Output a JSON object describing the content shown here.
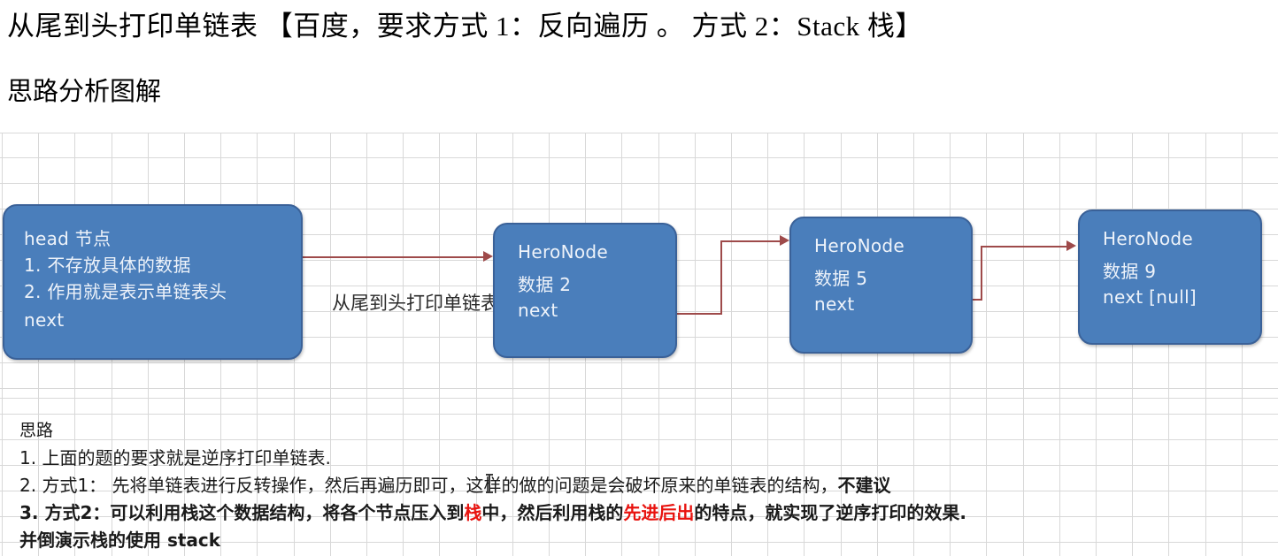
{
  "document": {
    "heading": "从尾到头打印单链表 【百度，要求方式 1：反向遍历 。 方式 2：Stack 栈】",
    "subheading": "思路分析图解"
  },
  "diagram": {
    "title": "从尾到头打印单链表",
    "node_fill": "#4a7ebb",
    "node_border": "#3a6198",
    "arrow_color": "#9e4a4a",
    "nodes": [
      {
        "id": "head",
        "lines": [
          "head 节点",
          "1. 不存放具体的数据",
          "2. 作用就是表示单链表头",
          "next"
        ]
      },
      {
        "id": "node2",
        "lines": [
          "HeroNode",
          "数据 2",
          "next"
        ]
      },
      {
        "id": "node3",
        "lines": [
          "HeroNode",
          "数据 5",
          "next"
        ]
      },
      {
        "id": "node4",
        "lines": [
          "HeroNode",
          "数据 9",
          "next [null]"
        ]
      }
    ]
  },
  "notes": {
    "title": "思路",
    "item1": "1. 上面的题的要求就是逆序打印单链表.",
    "item2_prefix": "2. 方式1： 先将单链表进行反转操作，然后再遍历即可，这样的做的问题是会破坏原来的单链表的结构，",
    "item2_bold": "不建议",
    "item3_a": "3. 方式2：可以利用栈这个数据结构，将各个节点压入到",
    "item3_red1": "栈",
    "item3_b": "中，然后利用栈的",
    "item3_red2": "先进后出",
    "item3_c": "的特点，就实现了逆序打印的效果.",
    "item4": "并倒演示栈的使用 stack"
  }
}
